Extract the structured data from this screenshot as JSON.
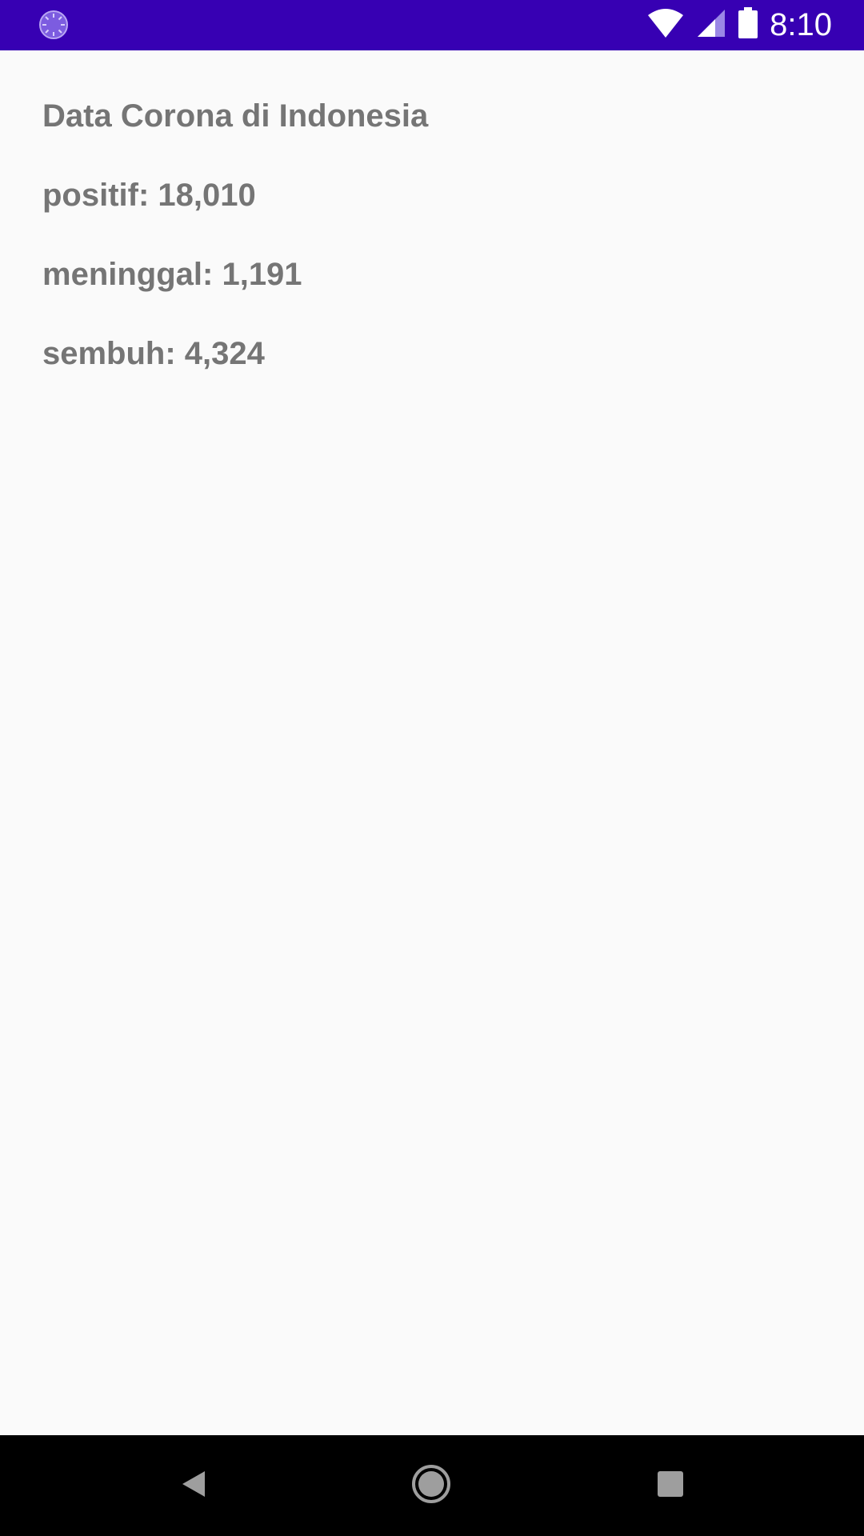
{
  "status_bar": {
    "time": "8:10",
    "background": "#3700b3",
    "icons": [
      "loading-indicator-icon",
      "wifi-icon",
      "cellular-signal-icon",
      "battery-icon"
    ]
  },
  "main": {
    "title": "Data Corona di Indonesia",
    "positive_line": "positif: 18,010",
    "deaths_line": "meninggal: 1,191",
    "recovered_line": "sembuh: 4,324",
    "text_color": "#757575"
  },
  "nav_bar": {
    "buttons": [
      "back-icon",
      "home-icon",
      "recents-icon"
    ]
  }
}
